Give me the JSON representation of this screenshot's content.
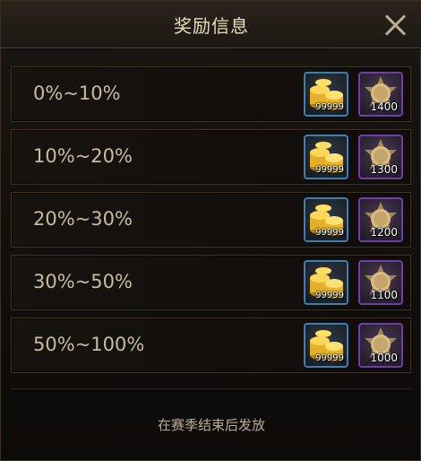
{
  "dialog": {
    "title": "奖励信息",
    "close_icon": "close-icon",
    "footer_text": "在赛季结束后发放"
  },
  "rows": [
    {
      "range": "0%~10%",
      "gold_qty": "99999",
      "medal_qty": "1400"
    },
    {
      "range": "10%~20%",
      "gold_qty": "99999",
      "medal_qty": "1300"
    },
    {
      "range": "20%~30%",
      "gold_qty": "99999",
      "medal_qty": "1200"
    },
    {
      "range": "30%~50%",
      "gold_qty": "99999",
      "medal_qty": "1100"
    },
    {
      "range": "50%~100%",
      "gold_qty": "99999",
      "medal_qty": "1000"
    }
  ],
  "icons": {
    "gold": "gold-coins-icon",
    "medal": "star-medal-icon"
  },
  "colors": {
    "gold_item_border": "#3f7fb0",
    "medal_item_border": "#6f3fa8",
    "title_text": "#eadcc0"
  }
}
